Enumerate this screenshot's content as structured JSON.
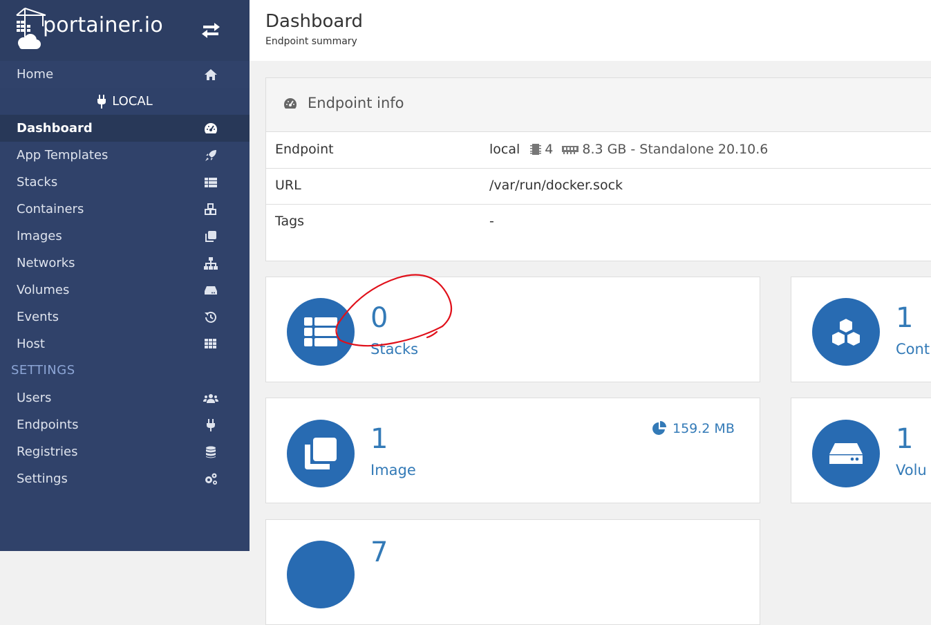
{
  "brand": {
    "logo_text": "portainer.io"
  },
  "sidebar": {
    "home": "Home",
    "endpoint_name": "LOCAL",
    "items": [
      {
        "label": "Dashboard",
        "icon": "tachometer-icon"
      },
      {
        "label": "App Templates",
        "icon": "rocket-icon"
      },
      {
        "label": "Stacks",
        "icon": "th-list-icon"
      },
      {
        "label": "Containers",
        "icon": "cubes-icon"
      },
      {
        "label": "Images",
        "icon": "clone-icon"
      },
      {
        "label": "Networks",
        "icon": "sitemap-icon"
      },
      {
        "label": "Volumes",
        "icon": "hdd-icon"
      },
      {
        "label": "Events",
        "icon": "history-icon"
      },
      {
        "label": "Host",
        "icon": "th-icon"
      }
    ],
    "settings_header": "SETTINGS",
    "settings_items": [
      {
        "label": "Users",
        "icon": "users-icon"
      },
      {
        "label": "Endpoints",
        "icon": "plug-icon"
      },
      {
        "label": "Registries",
        "icon": "database-icon"
      },
      {
        "label": "Settings",
        "icon": "cogs-icon"
      }
    ]
  },
  "header": {
    "title": "Dashboard",
    "subtitle": "Endpoint summary"
  },
  "endpoint_info": {
    "title": "Endpoint info",
    "rows": [
      {
        "key": "Endpoint",
        "name": "local",
        "cpu": "4",
        "memory": "8.3 GB",
        "details": "- Standalone 20.10.6"
      },
      {
        "key": "URL",
        "value": "/var/run/docker.sock"
      },
      {
        "key": "Tags",
        "value": "-"
      }
    ]
  },
  "tiles": {
    "stacks": {
      "count": "0",
      "label": "Stacks"
    },
    "containers": {
      "count": "1",
      "label": "Cont"
    },
    "images": {
      "count": "1",
      "label": "Image",
      "size": "159.2 MB"
    },
    "volumes": {
      "count": "1",
      "label": "Volu"
    },
    "networks": {
      "count": "7"
    }
  },
  "colors": {
    "sidebar_bg": "#30426a",
    "accent": "#286bb2",
    "link": "#337ab7",
    "annotation": "#e0101a"
  }
}
